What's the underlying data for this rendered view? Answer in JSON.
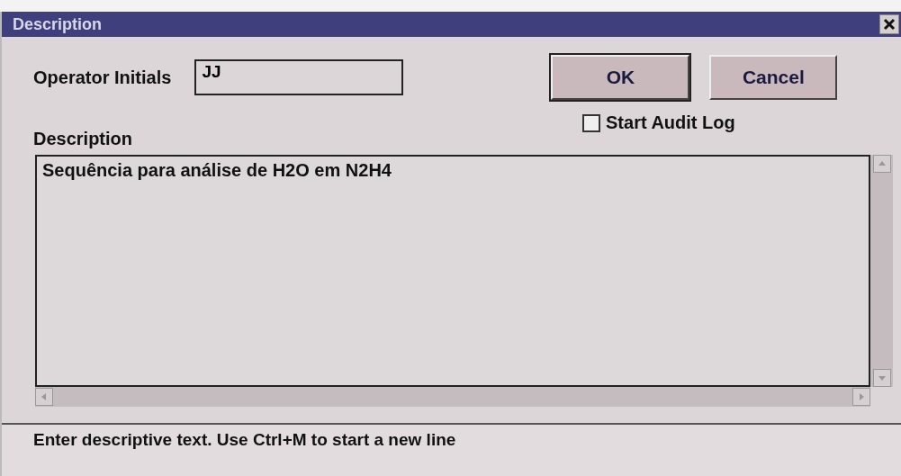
{
  "window": {
    "title": "Description"
  },
  "operator_initials": {
    "label": "Operator Initials",
    "value": "JJ"
  },
  "buttons": [
    {
      "label": "OK",
      "default": true
    },
    {
      "label": "Cancel",
      "default": false
    }
  ],
  "description": {
    "label": "Description",
    "value": "Sequência para análise de H2O em N2H4"
  },
  "audit_log": {
    "label": "Start Audit Log",
    "checked": false
  },
  "status_bar": "Enter descriptive text. Use Ctrl+M to start a new line"
}
